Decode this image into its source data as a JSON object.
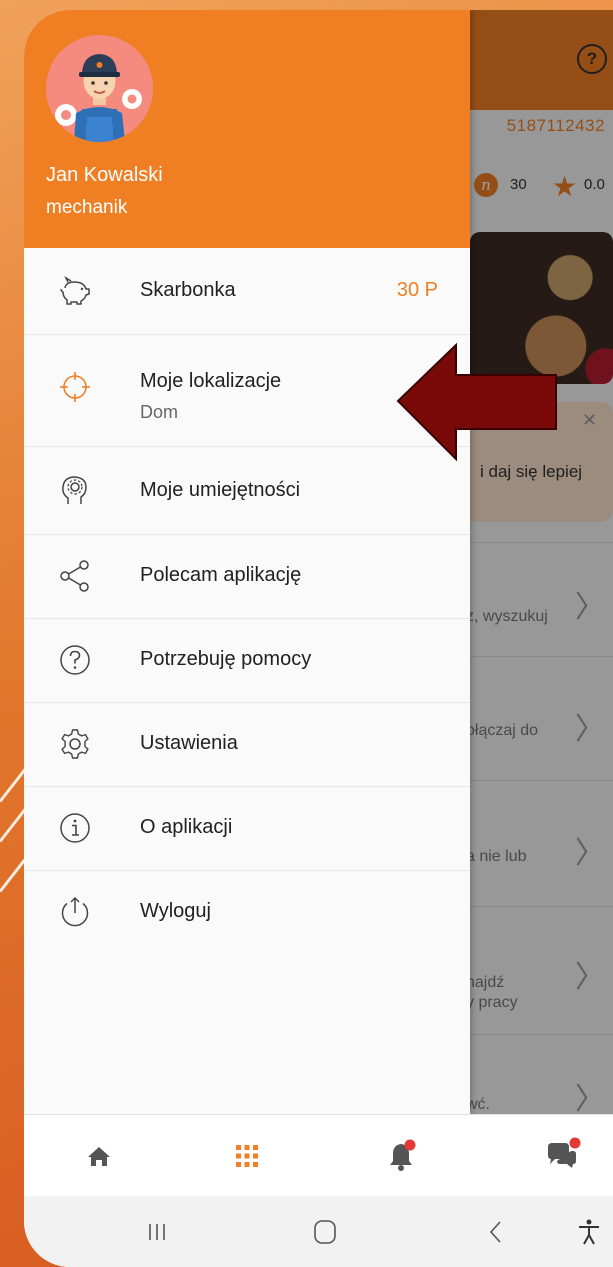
{
  "user": {
    "name": "Jan Kowalski",
    "role": "mechanik"
  },
  "menu": [
    {
      "label": "Skarbonka",
      "value": "30 P",
      "icon": "piggy-bank-icon"
    },
    {
      "label": "Moje lokalizacje",
      "sub": "Dom",
      "icon": "location-target-icon"
    },
    {
      "label": "Moje umiejętności",
      "icon": "brain-gear-icon"
    },
    {
      "label": "Polecam aplikację",
      "icon": "share-icon"
    },
    {
      "label": "Potrzebuję pomocy",
      "icon": "help-icon"
    },
    {
      "label": "Ustawienia",
      "icon": "settings-gear-icon"
    },
    {
      "label": "O aplikacji",
      "icon": "info-icon"
    },
    {
      "label": "Wyloguj",
      "icon": "logout-icon"
    }
  ],
  "background": {
    "phone_number": "5187112432",
    "points": "30",
    "rating": "0.0",
    "notice_text": "i daj się lepiej",
    "rows": [
      "z, wyszukuj",
      "ołączaj do",
      "a nie lub",
      "najdź",
      "y pracy",
      "wć."
    ]
  },
  "bottom_nav": [
    "home-icon",
    "grid-icon",
    "bell-icon",
    "chat-icon"
  ],
  "system_nav": [
    "recent-apps-icon",
    "home-button-icon",
    "back-icon",
    "accessibility-icon"
  ],
  "colors": {
    "accent": "#f07f24",
    "arrow": "#7a0a0a",
    "badge": "#e53935"
  }
}
